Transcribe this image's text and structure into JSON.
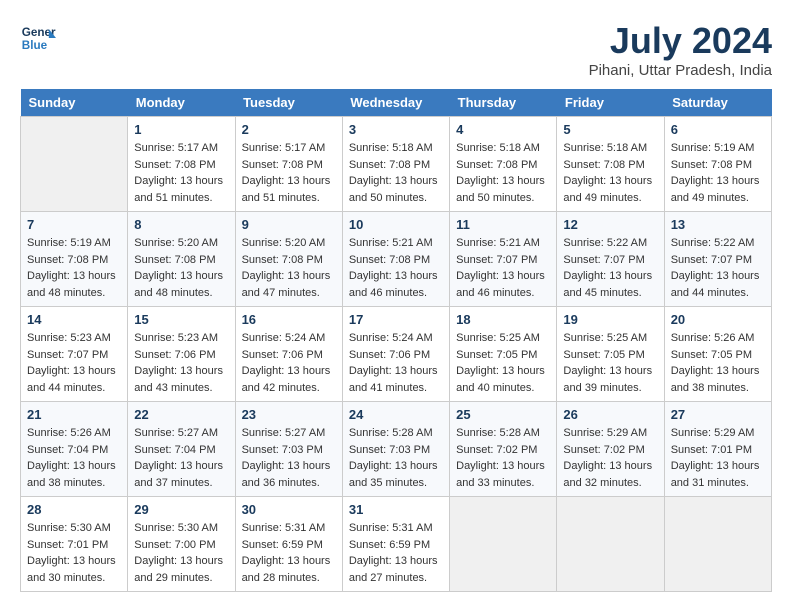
{
  "header": {
    "logo_line1": "General",
    "logo_line2": "Blue",
    "month_year": "July 2024",
    "location": "Pihani, Uttar Pradesh, India"
  },
  "weekdays": [
    "Sunday",
    "Monday",
    "Tuesday",
    "Wednesday",
    "Thursday",
    "Friday",
    "Saturday"
  ],
  "weeks": [
    [
      {
        "day": "",
        "empty": true
      },
      {
        "day": "1",
        "sunrise": "5:17 AM",
        "sunset": "7:08 PM",
        "daylight": "13 hours and 51 minutes."
      },
      {
        "day": "2",
        "sunrise": "5:17 AM",
        "sunset": "7:08 PM",
        "daylight": "13 hours and 51 minutes."
      },
      {
        "day": "3",
        "sunrise": "5:18 AM",
        "sunset": "7:08 PM",
        "daylight": "13 hours and 50 minutes."
      },
      {
        "day": "4",
        "sunrise": "5:18 AM",
        "sunset": "7:08 PM",
        "daylight": "13 hours and 50 minutes."
      },
      {
        "day": "5",
        "sunrise": "5:18 AM",
        "sunset": "7:08 PM",
        "daylight": "13 hours and 49 minutes."
      },
      {
        "day": "6",
        "sunrise": "5:19 AM",
        "sunset": "7:08 PM",
        "daylight": "13 hours and 49 minutes."
      }
    ],
    [
      {
        "day": "7",
        "sunrise": "5:19 AM",
        "sunset": "7:08 PM",
        "daylight": "13 hours and 48 minutes."
      },
      {
        "day": "8",
        "sunrise": "5:20 AM",
        "sunset": "7:08 PM",
        "daylight": "13 hours and 48 minutes."
      },
      {
        "day": "9",
        "sunrise": "5:20 AM",
        "sunset": "7:08 PM",
        "daylight": "13 hours and 47 minutes."
      },
      {
        "day": "10",
        "sunrise": "5:21 AM",
        "sunset": "7:08 PM",
        "daylight": "13 hours and 46 minutes."
      },
      {
        "day": "11",
        "sunrise": "5:21 AM",
        "sunset": "7:07 PM",
        "daylight": "13 hours and 46 minutes."
      },
      {
        "day": "12",
        "sunrise": "5:22 AM",
        "sunset": "7:07 PM",
        "daylight": "13 hours and 45 minutes."
      },
      {
        "day": "13",
        "sunrise": "5:22 AM",
        "sunset": "7:07 PM",
        "daylight": "13 hours and 44 minutes."
      }
    ],
    [
      {
        "day": "14",
        "sunrise": "5:23 AM",
        "sunset": "7:07 PM",
        "daylight": "13 hours and 44 minutes."
      },
      {
        "day": "15",
        "sunrise": "5:23 AM",
        "sunset": "7:06 PM",
        "daylight": "13 hours and 43 minutes."
      },
      {
        "day": "16",
        "sunrise": "5:24 AM",
        "sunset": "7:06 PM",
        "daylight": "13 hours and 42 minutes."
      },
      {
        "day": "17",
        "sunrise": "5:24 AM",
        "sunset": "7:06 PM",
        "daylight": "13 hours and 41 minutes."
      },
      {
        "day": "18",
        "sunrise": "5:25 AM",
        "sunset": "7:05 PM",
        "daylight": "13 hours and 40 minutes."
      },
      {
        "day": "19",
        "sunrise": "5:25 AM",
        "sunset": "7:05 PM",
        "daylight": "13 hours and 39 minutes."
      },
      {
        "day": "20",
        "sunrise": "5:26 AM",
        "sunset": "7:05 PM",
        "daylight": "13 hours and 38 minutes."
      }
    ],
    [
      {
        "day": "21",
        "sunrise": "5:26 AM",
        "sunset": "7:04 PM",
        "daylight": "13 hours and 38 minutes."
      },
      {
        "day": "22",
        "sunrise": "5:27 AM",
        "sunset": "7:04 PM",
        "daylight": "13 hours and 37 minutes."
      },
      {
        "day": "23",
        "sunrise": "5:27 AM",
        "sunset": "7:03 PM",
        "daylight": "13 hours and 36 minutes."
      },
      {
        "day": "24",
        "sunrise": "5:28 AM",
        "sunset": "7:03 PM",
        "daylight": "13 hours and 35 minutes."
      },
      {
        "day": "25",
        "sunrise": "5:28 AM",
        "sunset": "7:02 PM",
        "daylight": "13 hours and 33 minutes."
      },
      {
        "day": "26",
        "sunrise": "5:29 AM",
        "sunset": "7:02 PM",
        "daylight": "13 hours and 32 minutes."
      },
      {
        "day": "27",
        "sunrise": "5:29 AM",
        "sunset": "7:01 PM",
        "daylight": "13 hours and 31 minutes."
      }
    ],
    [
      {
        "day": "28",
        "sunrise": "5:30 AM",
        "sunset": "7:01 PM",
        "daylight": "13 hours and 30 minutes."
      },
      {
        "day": "29",
        "sunrise": "5:30 AM",
        "sunset": "7:00 PM",
        "daylight": "13 hours and 29 minutes."
      },
      {
        "day": "30",
        "sunrise": "5:31 AM",
        "sunset": "6:59 PM",
        "daylight": "13 hours and 28 minutes."
      },
      {
        "day": "31",
        "sunrise": "5:31 AM",
        "sunset": "6:59 PM",
        "daylight": "13 hours and 27 minutes."
      },
      {
        "day": "",
        "empty": true
      },
      {
        "day": "",
        "empty": true
      },
      {
        "day": "",
        "empty": true
      }
    ]
  ]
}
